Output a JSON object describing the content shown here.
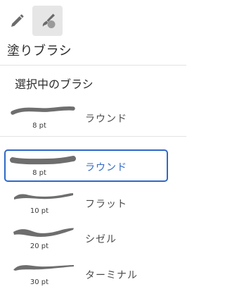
{
  "toolbar": {
    "tools": [
      {
        "icon": "pencil-icon",
        "active": false
      },
      {
        "icon": "paint-brush-icon",
        "active": true
      }
    ]
  },
  "panel": {
    "title": "塗りブラシ",
    "current_section_label": "選択中のブラシ",
    "accent_color": "#2f68c7"
  },
  "current_brush": {
    "name": "ラウンド",
    "size": "8 pt"
  },
  "brushes": [
    {
      "name": "ラウンド",
      "size": "8 pt",
      "selected": true
    },
    {
      "name": "フラット",
      "size": "10 pt",
      "selected": false
    },
    {
      "name": "シゼル",
      "size": "20 pt",
      "selected": false
    },
    {
      "name": "ターミナル",
      "size": "30 pt",
      "selected": false
    }
  ]
}
